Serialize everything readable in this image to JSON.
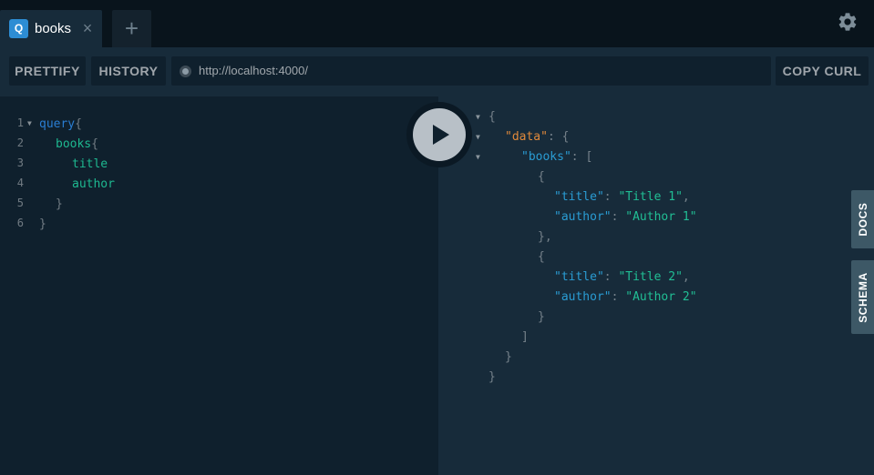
{
  "tabs": [
    {
      "badge": "Q",
      "title": "books",
      "close": "×"
    }
  ],
  "new_tab_label": "+",
  "toolbar": {
    "prettify_label": "PRETTIFY",
    "history_label": "HISTORY",
    "endpoint_url": "http://localhost:4000/",
    "copy_curl_label": "COPY CURL"
  },
  "query_editor": {
    "line_numbers": [
      "1",
      "2",
      "3",
      "4",
      "5",
      "6"
    ],
    "lines": [
      {
        "keyword": "query",
        "punct": "{"
      },
      {
        "field": "books",
        "punct": "{"
      },
      {
        "field": "title"
      },
      {
        "field": "author"
      },
      {
        "punct": "}"
      },
      {
        "punct": "}"
      }
    ]
  },
  "result": {
    "open_brace": "{",
    "data_key": "\"data\"",
    "books_key": "\"books\"",
    "items": [
      {
        "title_key": "\"title\"",
        "title_value": "\"Title 1\"",
        "author_key": "\"author\"",
        "author_value": "\"Author 1\""
      },
      {
        "title_key": "\"title\"",
        "title_value": "\"Title 2\"",
        "author_key": "\"author\"",
        "author_value": "\"Author 2\""
      }
    ]
  },
  "side_tabs": {
    "docs_label": "DOCS",
    "schema_label": "SCHEMA"
  },
  "colors": {
    "accent": "#2d8dd4",
    "keyword": "#2a7ed3",
    "field": "#1eb890",
    "string": "#21bf95",
    "root_key": "#e0893b"
  },
  "icons": [
    "gear-icon",
    "play-icon",
    "close-icon",
    "plus-icon",
    "fold-arrow-icon",
    "url-status-icon"
  ]
}
